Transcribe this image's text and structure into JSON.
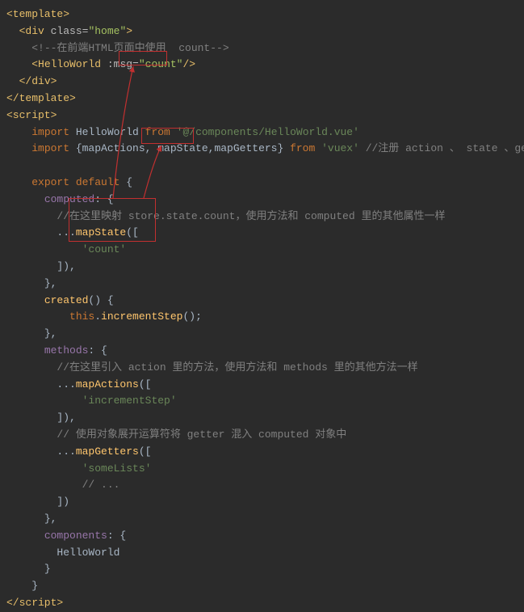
{
  "lines": {
    "l1": {
      "tag_open": "<template>",
      "tag_close": ""
    },
    "l2": {
      "prefix": "  ",
      "tag": "<div ",
      "attr": "class=",
      "val": "\"home\"",
      "close": ">"
    },
    "l3": {
      "prefix": "    ",
      "comment": "<!--在前端HTML页面中使用  count-->"
    },
    "l4": {
      "prefix": "    ",
      "tag": "<HelloWorld ",
      "attr": ":msg=",
      "val": "\"count\"",
      "close": "/>"
    },
    "l5": {
      "prefix": "  ",
      "tag": "</div>"
    },
    "l6": {
      "tag": "</template>"
    },
    "l7": {
      "tag": "<script>"
    },
    "l8": {
      "prefix": "    ",
      "kw1": "import ",
      "text1": "HelloWorld ",
      "kw2": "from ",
      "str": "'@/components/HelloWorld.vue'"
    },
    "l9": {
      "prefix": "    ",
      "kw1": "import ",
      "text1": "{mapActions, mapState,mapGetters} ",
      "kw2": "from ",
      "str": "'vuex'",
      "comment": " //注册 action 、 state 、getter"
    },
    "l10": "",
    "l11": {
      "prefix": "    ",
      "kw": "export default ",
      "brace": "{"
    },
    "l12": {
      "prefix": "      ",
      "name": "computed",
      "rest": ": {"
    },
    "l13": {
      "prefix": "        ",
      "comment": "//在这里映射 store.state.count，使用方法和 computed 里的其他属性一样"
    },
    "l14": {
      "prefix": "        ",
      "text": "...",
      "fn": "mapState",
      "rest": "(["
    },
    "l15": {
      "prefix": "            ",
      "str": "'count'"
    },
    "l16": {
      "prefix": "        ",
      "text": "]),"
    },
    "l17": {
      "prefix": "      ",
      "text": "},"
    },
    "l18": {
      "prefix": "      ",
      "fn": "created",
      "rest": "() {"
    },
    "l19": {
      "prefix": "          ",
      "kw": "this",
      "text": ".",
      "fn": "incrementStep",
      "rest": "();"
    },
    "l20": {
      "prefix": "      ",
      "text": "},"
    },
    "l21": {
      "prefix": "      ",
      "name": "methods",
      "rest": ": {"
    },
    "l22": {
      "prefix": "        ",
      "comment": "//在这里引入 action 里的方法，使用方法和 methods 里的其他方法一样"
    },
    "l23": {
      "prefix": "        ",
      "text": "...",
      "fn": "mapActions",
      "rest": "(["
    },
    "l24": {
      "prefix": "            ",
      "str": "'incrementStep'"
    },
    "l25": {
      "prefix": "        ",
      "text": "]),"
    },
    "l26": {
      "prefix": "        ",
      "comment": "// 使用对象展开运算符将 getter 混入 computed 对象中"
    },
    "l27": {
      "prefix": "        ",
      "text": "...",
      "fn": "mapGetters",
      "rest": "(["
    },
    "l28": {
      "prefix": "            ",
      "str": "'someLists'"
    },
    "l29": {
      "prefix": "            ",
      "comment": "// ..."
    },
    "l30": {
      "prefix": "        ",
      "text": "])"
    },
    "l31": {
      "prefix": "      ",
      "text": "},"
    },
    "l32": {
      "prefix": "      ",
      "name": "components",
      "rest": ": {"
    },
    "l33": {
      "prefix": "        ",
      "text": "HelloWorld"
    },
    "l34": {
      "prefix": "      ",
      "text": "}"
    },
    "l35": {
      "prefix": "    ",
      "text": "}"
    },
    "l36": {
      "tag": "</script>"
    }
  }
}
